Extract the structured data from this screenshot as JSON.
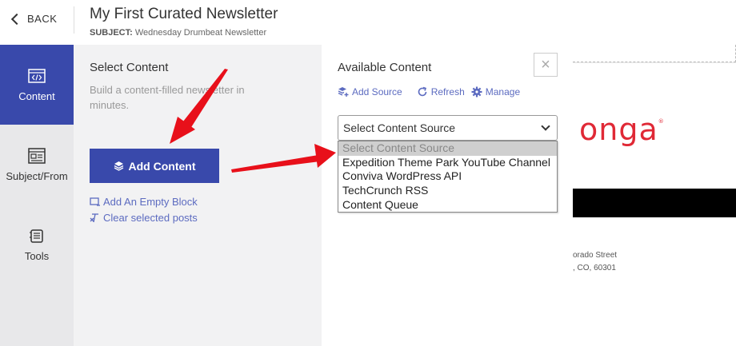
{
  "header": {
    "back_label": "BACK",
    "title": "My First Curated Newsletter",
    "subject_label": "SUBJECT:",
    "subject_value": "Wednesday Drumbeat Newsletter"
  },
  "nav": {
    "items": [
      {
        "label": "Content",
        "icon": "code-icon",
        "active": true
      },
      {
        "label": "Subject/From",
        "icon": "layout-icon",
        "active": false
      },
      {
        "label": "Tools",
        "icon": "tools-icon",
        "active": false
      }
    ]
  },
  "select_content": {
    "heading": "Select Content",
    "description": "Build a content-filled newsletter in minutes.",
    "add_button": "Add Content",
    "empty_block_link": "Add An Empty Block",
    "clear_link": "Clear selected posts"
  },
  "available_content": {
    "heading": "Available Content",
    "close_symbol": "×",
    "add_source": "Add Source",
    "refresh": "Refresh",
    "manage": "Manage",
    "select_value": "Select Content Source",
    "options": [
      "Select Content Source",
      "Expedition Theme Park YouTube Channel",
      "Conviva WordPress API",
      "TechCrunch RSS",
      "Content Queue"
    ]
  },
  "preview": {
    "logo_text": "onga",
    "logo_mark": "®",
    "address_line1": "orado Street",
    "address_line2": ", CO, 60301"
  },
  "colors": {
    "accent": "#3949ab",
    "link": "#5c6bc0",
    "arrow": "#e8101a",
    "logo": "#e02936"
  }
}
